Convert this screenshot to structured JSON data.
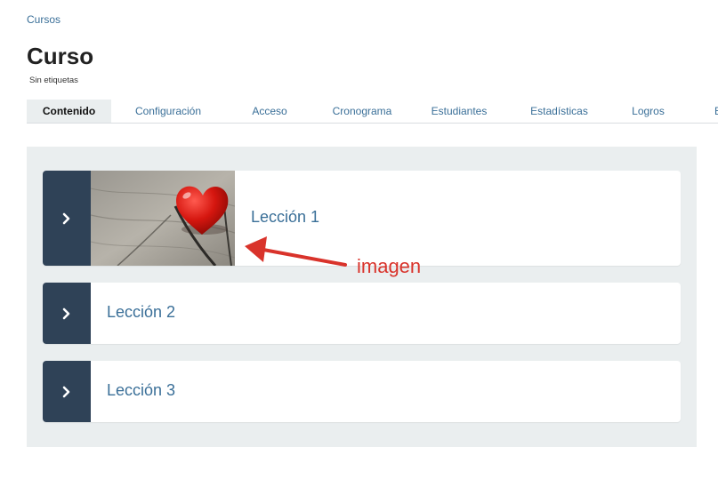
{
  "breadcrumb": {
    "label": "Cursos"
  },
  "page": {
    "title": "Curso",
    "tags": "Sin etiquetas"
  },
  "tabs": [
    {
      "label": "Contenido",
      "active": true
    },
    {
      "label": "Configuración"
    },
    {
      "label": "Acceso"
    },
    {
      "label": "Cronograma"
    },
    {
      "label": "Estudiantes"
    },
    {
      "label": "Estadísticas"
    },
    {
      "label": "Logros"
    },
    {
      "label": "E"
    }
  ],
  "lessons": [
    {
      "title": "Lección 1",
      "icon": "chevron-right-icon",
      "has_image": true,
      "image": "heart-on-wood"
    },
    {
      "title": "Lección 2",
      "icon": "chevron-right-icon",
      "has_image": false
    },
    {
      "title": "Lección 3",
      "icon": "chevron-right-icon",
      "has_image": false
    }
  ],
  "annotation": {
    "label": "imagen",
    "color": "#d9332b"
  },
  "colors": {
    "link": "#3a6f98",
    "toggle": "#2f4257",
    "panel": "#eaeeef"
  }
}
